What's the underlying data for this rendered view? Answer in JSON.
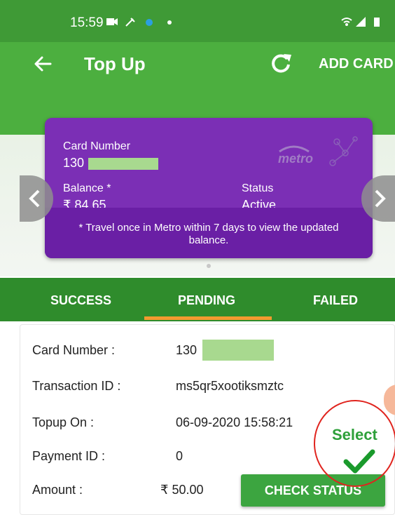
{
  "status_bar": {
    "time": "15:59"
  },
  "app_bar": {
    "title": "Top Up",
    "add_card": "ADD CARD",
    "icons": [
      "back-arrow-icon",
      "refresh-icon"
    ]
  },
  "card": {
    "number_label": "Card Number",
    "number_visible": "130",
    "balance_label": "Balance *",
    "balance_value": "₹ 84.65",
    "status_label": "Status",
    "status_value": "Active",
    "note": "* Travel once in Metro within 7 days to view the updated balance.",
    "color": "#7b2fb5"
  },
  "tabs": {
    "items": [
      "SUCCESS",
      "PENDING",
      "FAILED"
    ],
    "selected": "PENDING"
  },
  "transaction": {
    "card_number_label": "Card Number :",
    "card_number_value": "130",
    "transaction_id_label": "Transaction ID :",
    "transaction_id_value": "ms5qr5xootiksmztc",
    "topup_on_label": "Topup On :",
    "topup_on_value": "06-09-2020 15:58:21",
    "payment_id_label": "Payment ID :",
    "payment_id_value": "0",
    "amount_label": "Amount :",
    "amount_value": "₹ 50.00",
    "check_status": "CHECK STATUS"
  },
  "annotation": {
    "select_label": "Select"
  },
  "colors": {
    "primary": "#4caf3f",
    "tab_bar": "#2f8c2c",
    "indicator": "#f39a2f",
    "annotation": "#e0241e"
  }
}
